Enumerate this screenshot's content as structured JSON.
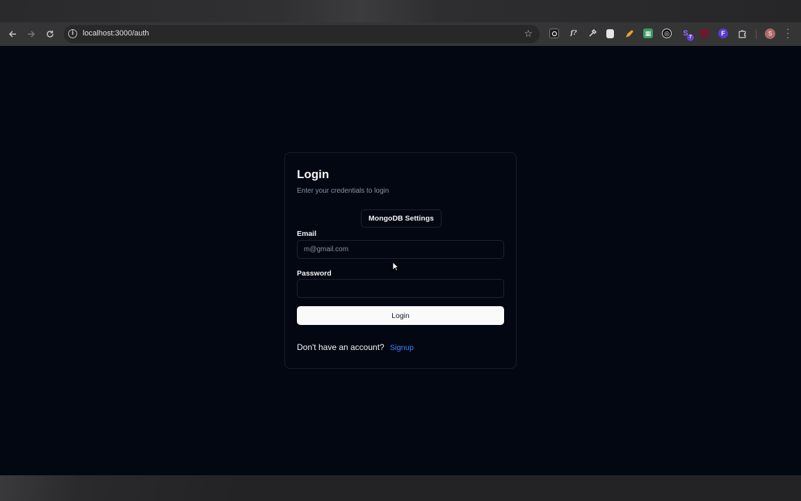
{
  "browser": {
    "url": "localhost:3000/auth",
    "icons": {
      "back": "arrow-left-icon",
      "forward": "arrow-right-icon",
      "reload": "reload-icon",
      "site_info": "info-icon",
      "bookmark": "star-icon",
      "extensions": "puzzle-icon",
      "menu": "more-vert-icon"
    },
    "extension_badge": "7",
    "profile_initial": "S"
  },
  "login": {
    "title": "Login",
    "description": "Enter your credentials to login",
    "mongodb_button": "MongoDB Settings",
    "email_label": "Email",
    "email_placeholder": "m@gmail.com",
    "email_value": "",
    "password_label": "Password",
    "password_value": "",
    "submit_label": "Login",
    "no_account_text": "Don't have an account?",
    "signup_link": "Signup"
  },
  "colors": {
    "page_bg": "#030712",
    "card_border": "#1a1f2b",
    "primary_button": "#fafafa",
    "link": "#3b82f6"
  }
}
